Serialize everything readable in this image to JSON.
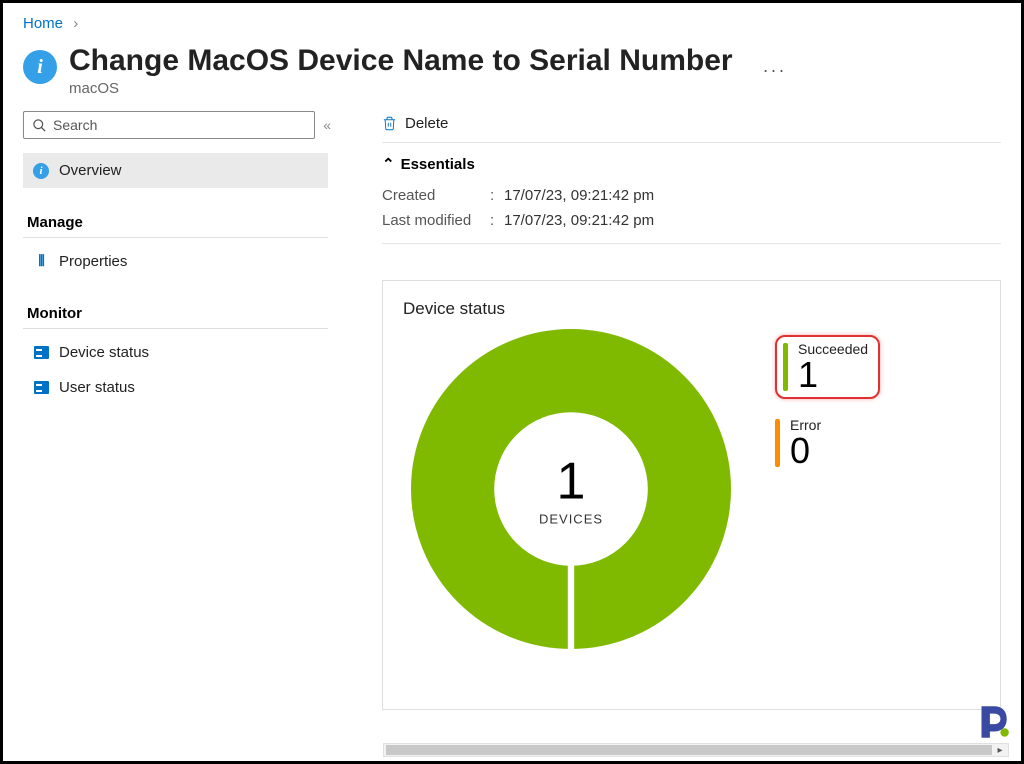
{
  "breadcrumb": {
    "home": "Home"
  },
  "header": {
    "title": "Change MacOS Device Name to Serial Number",
    "subtitle": "macOS",
    "more": "···"
  },
  "sidebar": {
    "search_placeholder": "Search",
    "overview": "Overview",
    "manage_heading": "Manage",
    "properties": "Properties",
    "monitor_heading": "Monitor",
    "device_status": "Device status",
    "user_status": "User status"
  },
  "toolbar": {
    "delete": "Delete"
  },
  "essentials": {
    "heading": "Essentials",
    "created_label": "Created",
    "created_value": "17/07/23, 09:21:42 pm",
    "modified_label": "Last modified",
    "modified_value": "17/07/23, 09:21:42 pm"
  },
  "card": {
    "title": "Device status",
    "donut_value": "1",
    "donut_label": "DEVICES",
    "legend_succeeded_label": "Succeeded",
    "legend_succeeded_value": "1",
    "legend_error_label": "Error",
    "legend_error_value": "0"
  },
  "chart_data": {
    "type": "pie",
    "title": "Device status",
    "categories": [
      "Succeeded",
      "Error"
    ],
    "values": [
      1,
      0
    ],
    "colors": [
      "#7fba00",
      "#ff8c00"
    ],
    "center_label": "DEVICES",
    "center_value": 1
  }
}
